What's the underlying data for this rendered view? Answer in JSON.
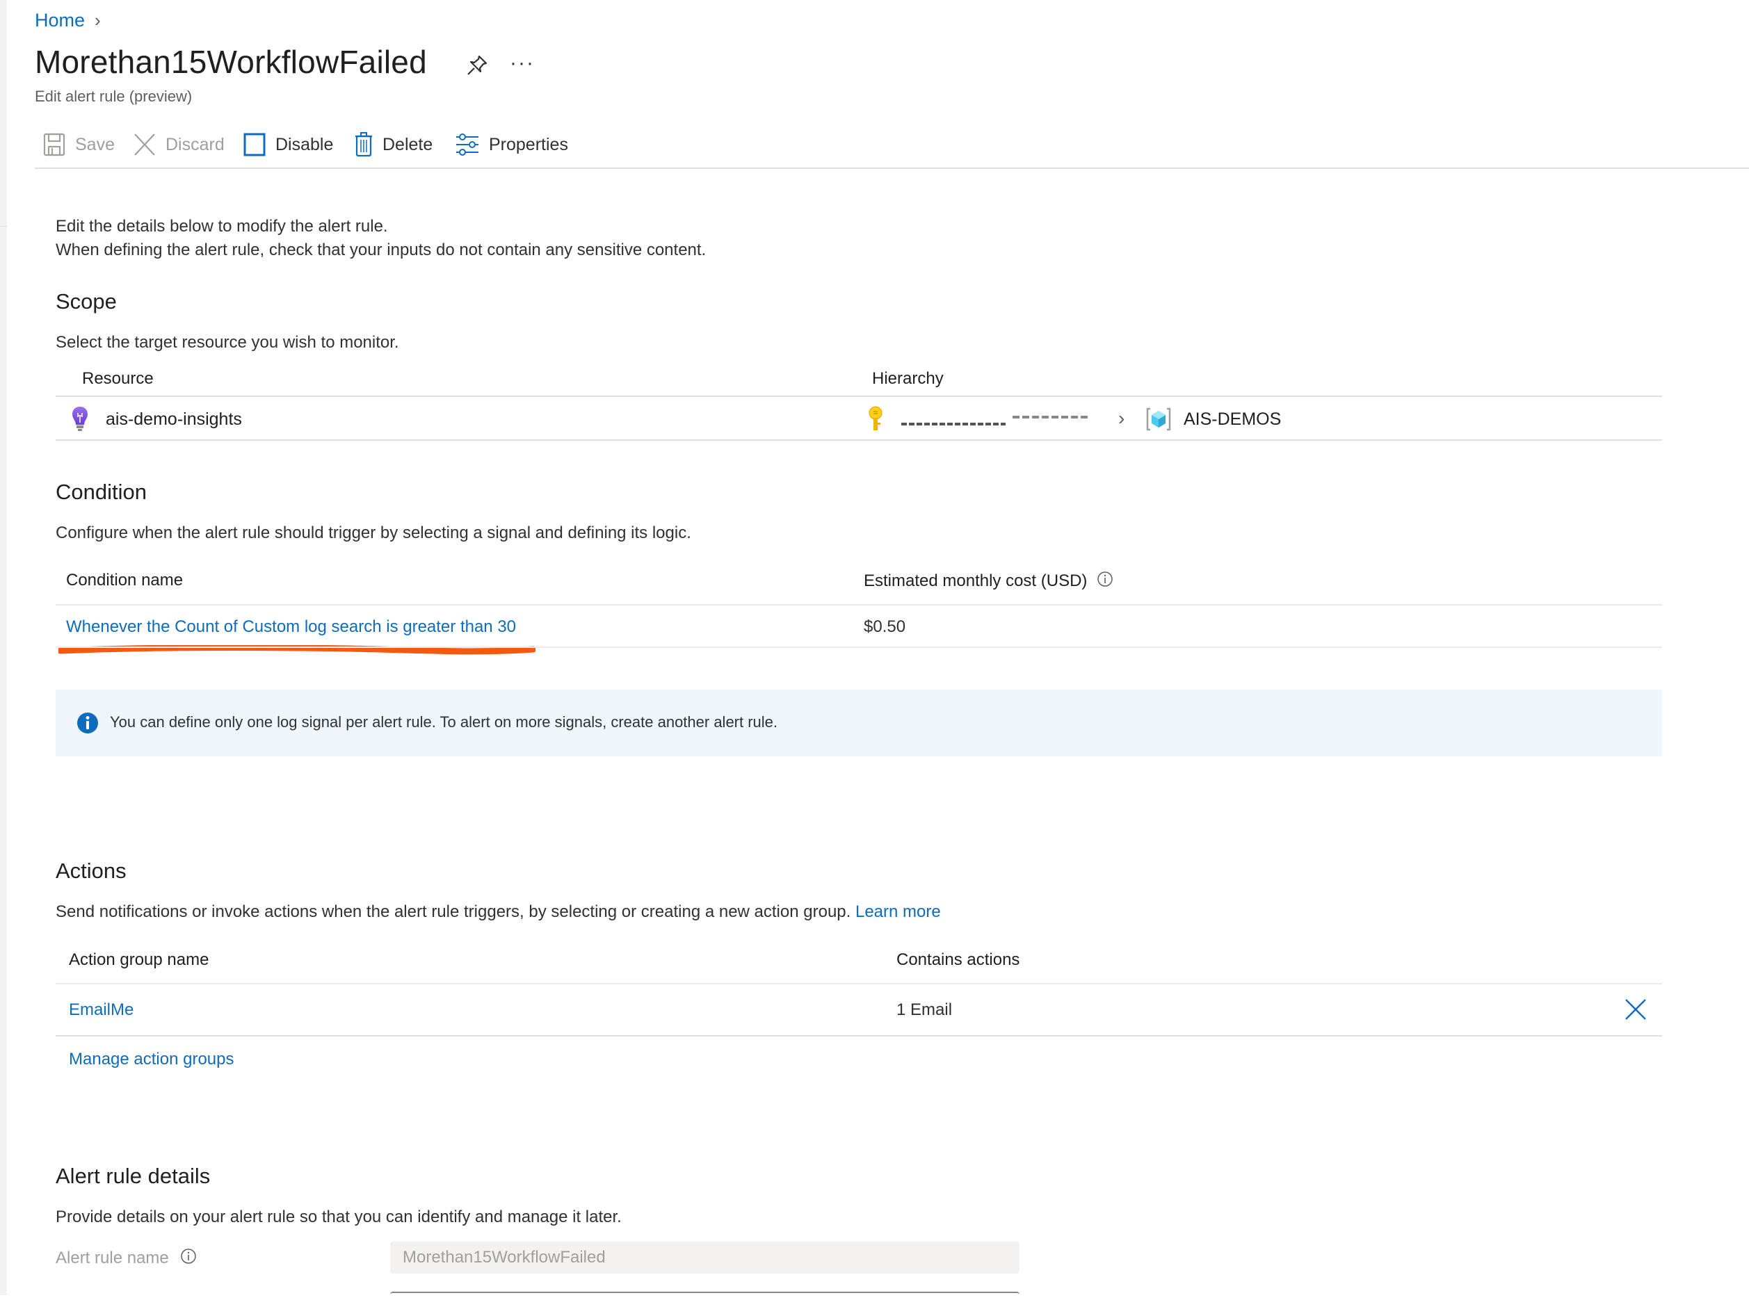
{
  "breadcrumb": {
    "items": [
      {
        "label": "Home"
      }
    ]
  },
  "header": {
    "title": "Morethan15WorkflowFailed",
    "subtitle": "Edit alert rule (preview)",
    "more_label": "···"
  },
  "toolbar": {
    "save_label": "Save",
    "discard_label": "Discard",
    "disable_label": "Disable",
    "delete_label": "Delete",
    "properties_label": "Properties"
  },
  "intro": {
    "line1": "Edit the details below to modify the alert rule.",
    "line2": "When defining the alert rule, check that your inputs do not contain any sensitive content."
  },
  "scope": {
    "heading": "Scope",
    "description": "Select the target resource you wish to monitor.",
    "columns": [
      "Resource",
      "Hierarchy"
    ],
    "rows": [
      {
        "resource": "ais-demo-insights",
        "hierarchy": {
          "subscription": "[redacted]",
          "resource_group": "AIS-DEMOS"
        }
      }
    ]
  },
  "condition": {
    "heading": "Condition",
    "description": "Configure when the alert rule should trigger by selecting a signal and defining its logic.",
    "columns": [
      "Condition name",
      "Estimated monthly cost (USD)"
    ],
    "rows": [
      {
        "name": "Whenever the Count of Custom log search is greater than 30",
        "cost": "$0.50"
      }
    ],
    "info_banner": "You can define only one log signal per alert rule. To alert on more signals, create another alert rule."
  },
  "actions": {
    "heading": "Actions",
    "description": "Send notifications or invoke actions when the alert rule triggers, by selecting or creating a new action group.",
    "learn_more": "Learn more",
    "columns": [
      "Action group name",
      "Contains actions"
    ],
    "rows": [
      {
        "name": "EmailMe",
        "contains": "1 Email"
      }
    ],
    "manage_label": "Manage action groups"
  },
  "details": {
    "heading": "Alert rule details",
    "description": "Provide details on your alert rule so that you can identify and manage it later.",
    "rule_name_label": "Alert rule name",
    "rule_name_value": "Morethan15WorkflowFailed"
  },
  "colors": {
    "link": "#0f6cbd",
    "annotation_underline": "#f25a12",
    "info_banner_bg": "#eff6fc",
    "info_icon": "#0f6cbd"
  }
}
